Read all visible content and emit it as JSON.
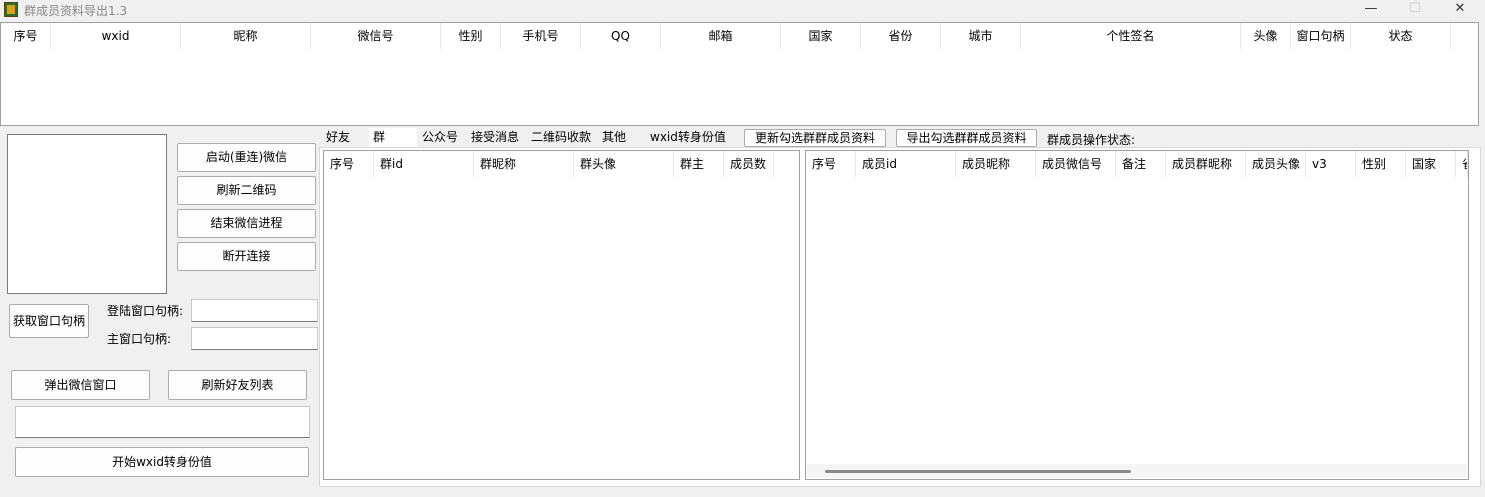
{
  "window": {
    "title": "群成员资料导出1.3",
    "minimize": "—",
    "maximize": "☐",
    "close": "✕"
  },
  "top_table": {
    "columns": [
      "序号",
      "wxid",
      "昵称",
      "微信号",
      "性别",
      "手机号",
      "QQ",
      "邮箱",
      "国家",
      "省份",
      "城市",
      "个性签名",
      "头像",
      "窗口句柄",
      "状态"
    ]
  },
  "left": {
    "start_wechat": "启动(重连)微信",
    "refresh_qr": "刷新二维码",
    "end_process": "结束微信进程",
    "disconnect": "断开连接",
    "get_handle": "获取窗口句柄",
    "login_handle_label": "登陆窗口句柄:",
    "login_handle_value": "",
    "main_handle_label": "主窗口句柄:",
    "main_handle_value": "",
    "popup_window": "弹出微信窗口",
    "refresh_friends": "刷新好友列表",
    "text_field_value": "",
    "start_wxid": "开始wxid转身份值"
  },
  "tabs": {
    "items": [
      "好友",
      "群",
      "公众号",
      "接受消息",
      "二维码收款",
      "其他",
      "wxid转身份值"
    ],
    "active": "群"
  },
  "group_panel": {
    "update_button": "更新勾选群群成员资料",
    "export_button": "导出勾选群群成员资料",
    "status_label": "群成员操作状态:",
    "groups_columns": [
      "序号",
      "群id",
      "群昵称",
      "群头像",
      "群主",
      "成员数"
    ],
    "members_columns": [
      "序号",
      "成员id",
      "成员昵称",
      "成员微信号",
      "备注",
      "成员群昵称",
      "成员头像",
      "v3",
      "性别",
      "国家",
      "省"
    ]
  }
}
